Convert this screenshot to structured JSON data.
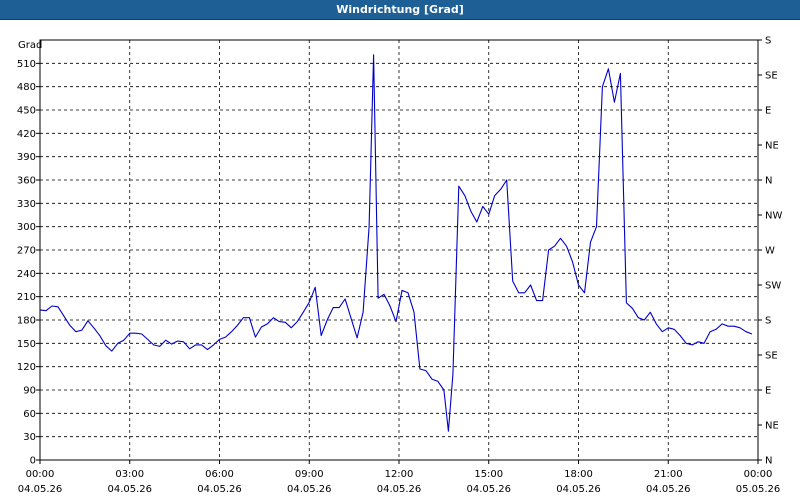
{
  "window": {
    "title": "Windrichtung [Grad]"
  },
  "chart_data": {
    "type": "line",
    "title": "Windrichtung [Grad]",
    "ylabel": "Grad",
    "ylim": [
      0,
      540
    ],
    "yticks": [
      0,
      30,
      60,
      90,
      120,
      150,
      180,
      210,
      240,
      270,
      300,
      330,
      360,
      390,
      420,
      450,
      480,
      510
    ],
    "right_axis_labels": [
      "N",
      "NE",
      "E",
      "SE",
      "S",
      "SW",
      "W",
      "NW",
      "N",
      "NE",
      "E",
      "SE",
      "S"
    ],
    "xlim_hours": [
      0,
      24
    ],
    "x_ticks": [
      {
        "time": "00:00",
        "date": "04.05.26"
      },
      {
        "time": "03:00",
        "date": "04.05.26"
      },
      {
        "time": "06:00",
        "date": "04.05.26"
      },
      {
        "time": "09:00",
        "date": "04.05.26"
      },
      {
        "time": "12:00",
        "date": "04.05.26"
      },
      {
        "time": "15:00",
        "date": "04.05.26"
      },
      {
        "time": "18:00",
        "date": "04.05.26"
      },
      {
        "time": "21:00",
        "date": "04.05.26"
      },
      {
        "time": "00:00",
        "date": "05.05.26"
      }
    ],
    "grid": true,
    "line_color": "#0000cc",
    "series": [
      {
        "points": [
          [
            0.0,
            193
          ],
          [
            0.2,
            192
          ],
          [
            0.4,
            198
          ],
          [
            0.6,
            197
          ],
          [
            0.8,
            185
          ],
          [
            1.0,
            173
          ],
          [
            1.2,
            165
          ],
          [
            1.4,
            167
          ],
          [
            1.6,
            179
          ],
          [
            1.8,
            170
          ],
          [
            2.0,
            160
          ],
          [
            2.2,
            147
          ],
          [
            2.4,
            140
          ],
          [
            2.6,
            150
          ],
          [
            2.8,
            154
          ],
          [
            3.0,
            163
          ],
          [
            3.2,
            163
          ],
          [
            3.4,
            162
          ],
          [
            3.6,
            155
          ],
          [
            3.8,
            148
          ],
          [
            4.0,
            146
          ],
          [
            4.2,
            154
          ],
          [
            4.4,
            149
          ],
          [
            4.6,
            153
          ],
          [
            4.8,
            152
          ],
          [
            5.0,
            143
          ],
          [
            5.2,
            148
          ],
          [
            5.4,
            148
          ],
          [
            5.6,
            142
          ],
          [
            5.8,
            148
          ],
          [
            6.0,
            155
          ],
          [
            6.2,
            158
          ],
          [
            6.4,
            165
          ],
          [
            6.6,
            173
          ],
          [
            6.8,
            183
          ],
          [
            7.0,
            183
          ],
          [
            7.2,
            158
          ],
          [
            7.4,
            171
          ],
          [
            7.6,
            175
          ],
          [
            7.8,
            183
          ],
          [
            8.0,
            178
          ],
          [
            8.2,
            177
          ],
          [
            8.4,
            170
          ],
          [
            8.6,
            178
          ],
          [
            8.8,
            190
          ],
          [
            9.0,
            203
          ],
          [
            9.2,
            222
          ],
          [
            9.4,
            160
          ],
          [
            9.6,
            180
          ],
          [
            9.8,
            196
          ],
          [
            10.0,
            196
          ],
          [
            10.2,
            207
          ],
          [
            10.4,
            182
          ],
          [
            10.6,
            157
          ],
          [
            10.8,
            190
          ],
          [
            11.0,
            300
          ],
          [
            11.15,
            521
          ],
          [
            11.3,
            208
          ],
          [
            11.5,
            213
          ],
          [
            11.7,
            198
          ],
          [
            11.9,
            178
          ],
          [
            12.1,
            218
          ],
          [
            12.3,
            215
          ],
          [
            12.5,
            190
          ],
          [
            12.7,
            117
          ],
          [
            12.9,
            115
          ],
          [
            13.1,
            104
          ],
          [
            13.3,
            101
          ],
          [
            13.5,
            90
          ],
          [
            13.65,
            37
          ],
          [
            13.8,
            110
          ],
          [
            14.0,
            352
          ],
          [
            14.2,
            340
          ],
          [
            14.4,
            320
          ],
          [
            14.6,
            306
          ],
          [
            14.8,
            326
          ],
          [
            15.0,
            316
          ],
          [
            15.2,
            340
          ],
          [
            15.4,
            348
          ],
          [
            15.6,
            360
          ],
          [
            15.8,
            230
          ],
          [
            16.0,
            215
          ],
          [
            16.2,
            215
          ],
          [
            16.4,
            225
          ],
          [
            16.6,
            205
          ],
          [
            16.8,
            205
          ],
          [
            17.0,
            270
          ],
          [
            17.2,
            275
          ],
          [
            17.4,
            285
          ],
          [
            17.6,
            275
          ],
          [
            17.8,
            255
          ],
          [
            18.0,
            225
          ],
          [
            18.2,
            215
          ],
          [
            18.4,
            280
          ],
          [
            18.6,
            300
          ],
          [
            18.8,
            480
          ],
          [
            19.0,
            503
          ],
          [
            19.2,
            460
          ],
          [
            19.4,
            497
          ],
          [
            19.6,
            202
          ],
          [
            19.8,
            195
          ],
          [
            20.0,
            183
          ],
          [
            20.2,
            180
          ],
          [
            20.4,
            190
          ],
          [
            20.6,
            175
          ],
          [
            20.8,
            165
          ],
          [
            21.0,
            170
          ],
          [
            21.2,
            168
          ],
          [
            21.4,
            160
          ],
          [
            21.6,
            150
          ],
          [
            21.8,
            148
          ],
          [
            22.0,
            152
          ],
          [
            22.2,
            150
          ],
          [
            22.4,
            165
          ],
          [
            22.6,
            168
          ],
          [
            22.8,
            175
          ],
          [
            23.0,
            172
          ],
          [
            23.2,
            172
          ],
          [
            23.4,
            170
          ],
          [
            23.6,
            165
          ],
          [
            23.8,
            162
          ]
        ]
      }
    ]
  }
}
